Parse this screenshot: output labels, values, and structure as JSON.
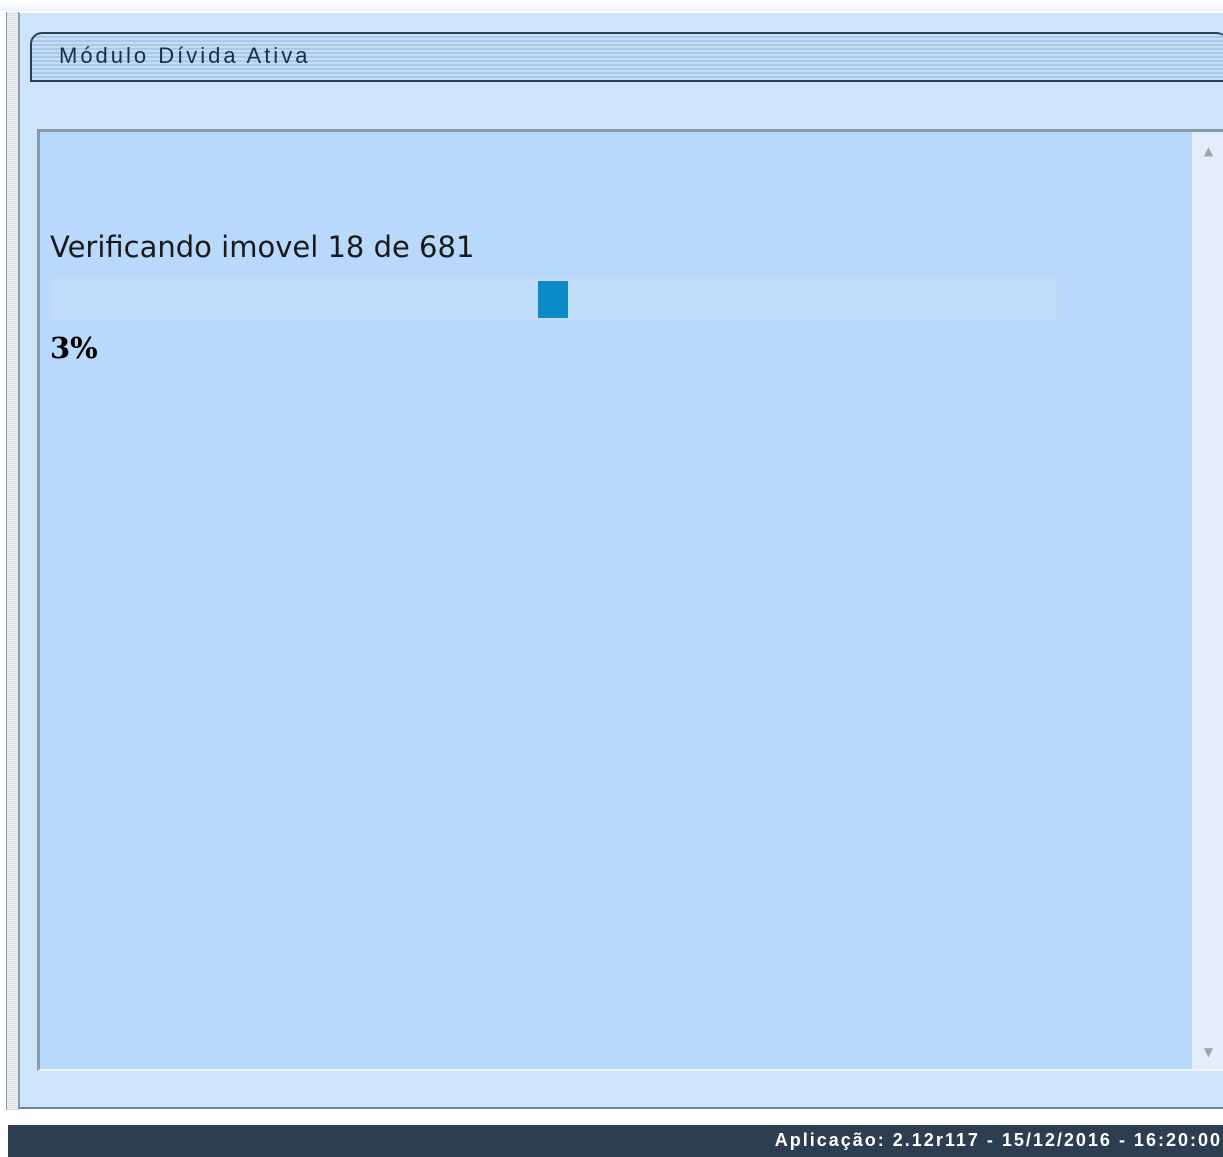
{
  "module": {
    "title": "Módulo Dívida Ativa"
  },
  "progress": {
    "status_text": "Verificando imovel 18 de 681",
    "current": 18,
    "total": 681,
    "percent_label": "3%",
    "percent_value": 3,
    "bar_color": "#0a8bc7"
  },
  "scrollbar": {
    "up_icon": "scroll-up-arrow-icon",
    "down_icon": "scroll-down-arrow-icon"
  },
  "footer": {
    "app_info": "Aplicação: 2.12r117 - 15/12/2016 - 16:20:00"
  },
  "colors": {
    "panel_background": "#b8d9fb",
    "frame_background": "#cde4fb",
    "footer_background": "#2c3e50"
  }
}
